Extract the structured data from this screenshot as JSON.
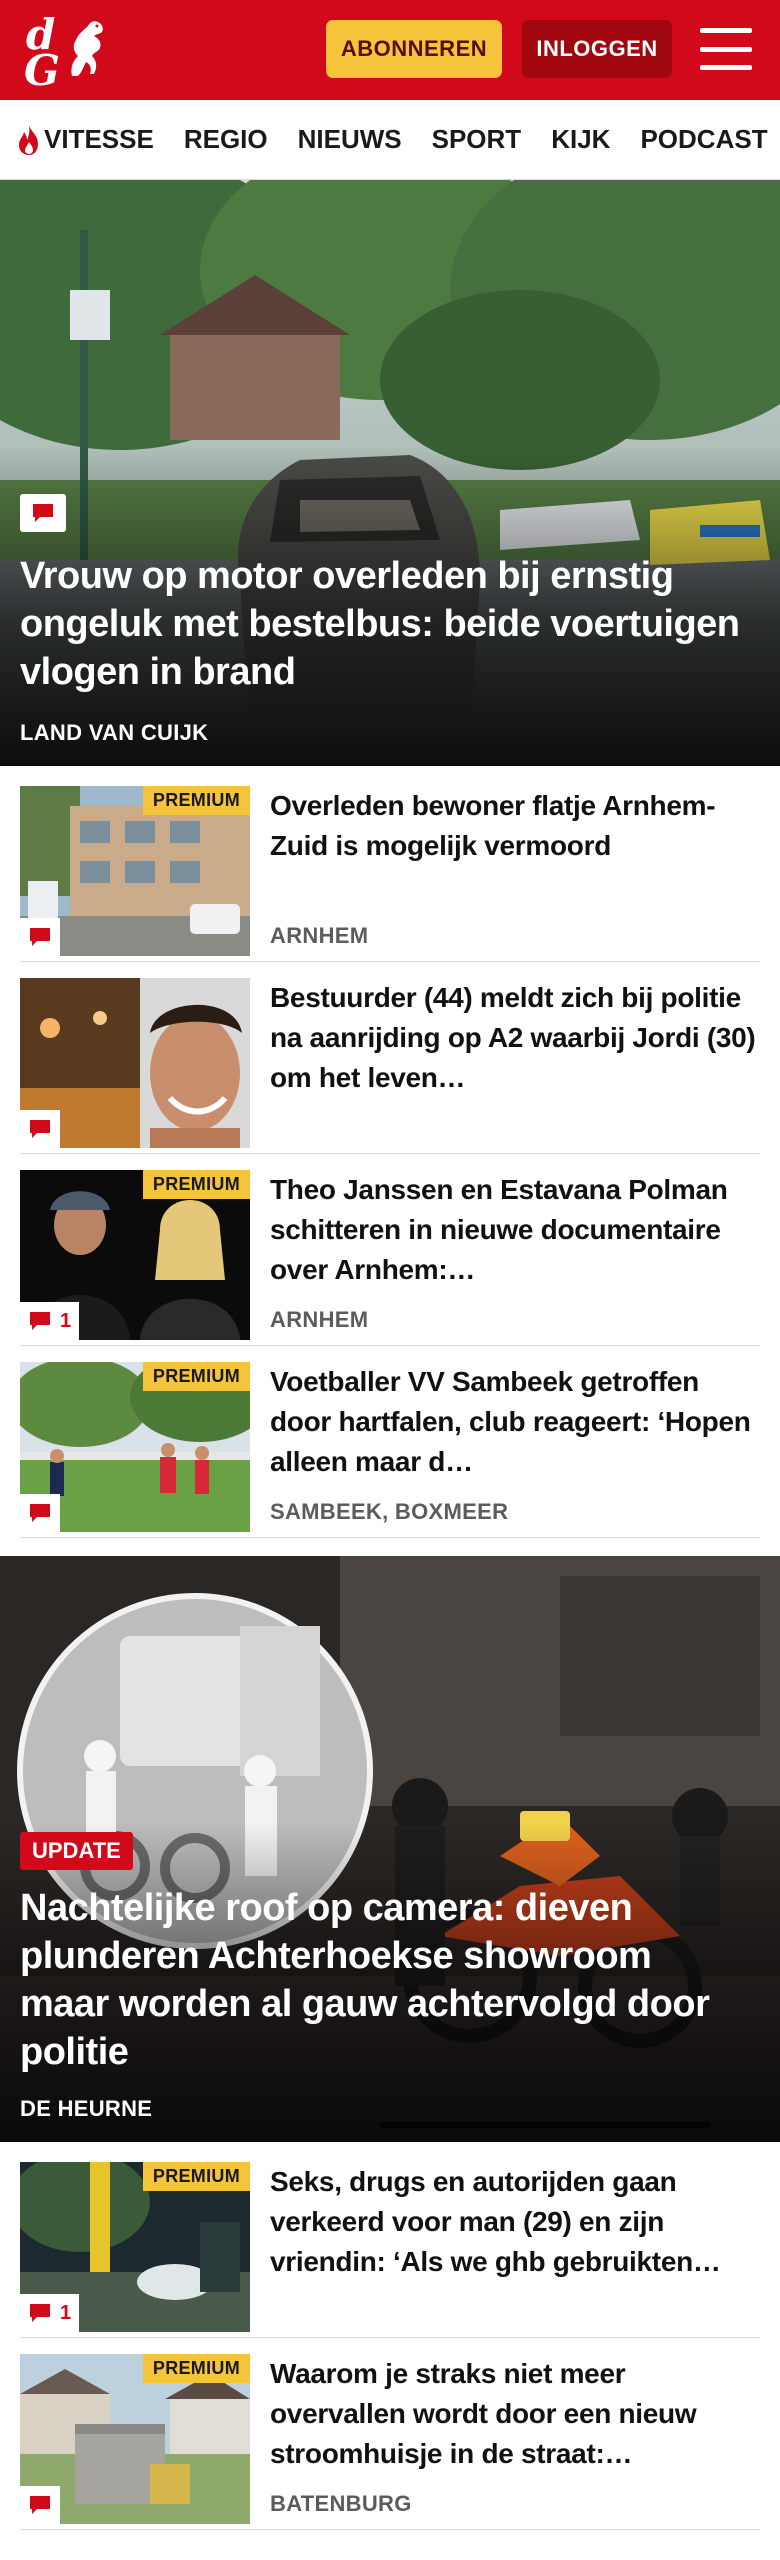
{
  "header": {
    "logo_text_d": "d",
    "logo_text_g": "G",
    "subscribe_label": "ABONNEREN",
    "login_label": "INLOGGEN"
  },
  "nav": {
    "items": [
      {
        "label": "VITESSE",
        "icon": "flame-icon"
      },
      {
        "label": "REGIO"
      },
      {
        "label": "NIEUWS"
      },
      {
        "label": "SPORT"
      },
      {
        "label": "KIJK"
      },
      {
        "label": "PODCAST"
      }
    ]
  },
  "hero1": {
    "title": "Vrouw op motor overleden bij ernstig ongeluk met bestelbus: beide voertuigen vlogen in brand",
    "location": "LAND VAN CUIJK",
    "icon": "comment-icon"
  },
  "articles1": [
    {
      "title": "Overleden bewoner flatje Arn­hem-Zuid is mogelijk vermoord",
      "location": "ARNHEM",
      "premium": "PREMIUM",
      "comments": ""
    },
    {
      "title": "Bestuurder (44) meldt zich bij politie na aanrijding op A2 waarbij Jordi (30) om het leven…",
      "location": "",
      "premium": "",
      "comments": ""
    },
    {
      "title": "Theo Janssen en Estavana Polman schitteren in nieuwe documentaire over Arnhem:…",
      "location": "ARNHEM",
      "premium": "PREMIUM",
      "comments": "1"
    },
    {
      "title": "Voetballer VV Sambeek getroffen door hartfalen, club reageert: ‘Hopen alleen maar d…",
      "location": "SAMBEEK, BOXMEER",
      "premium": "PREMIUM",
      "comments": ""
    }
  ],
  "hero2": {
    "badge": "UPDATE",
    "title": "Nachtelijke roof op camera: dieven plunderen Achterhoekse showroom maar worden al gauw achtervolgd door politie",
    "location": "DE HEURNE"
  },
  "articles2": [
    {
      "title": "Seks, drugs en autorijden gaan verkeerd voor man (29) en zijn vriendin: ‘Als we ghb gebruikten…",
      "location": "",
      "premium": "PREMIUM",
      "comments": "1"
    },
    {
      "title": "Waarom je straks niet meer overvallen wordt door een nieuw stroomhuisje in de straat:…",
      "location": "BATENBURG",
      "premium": "PREMIUM",
      "comments": ""
    }
  ],
  "colors": {
    "brand_red": "#d2091a",
    "dark_red": "#a1070f",
    "premium_yellow": "#f6c43a"
  }
}
